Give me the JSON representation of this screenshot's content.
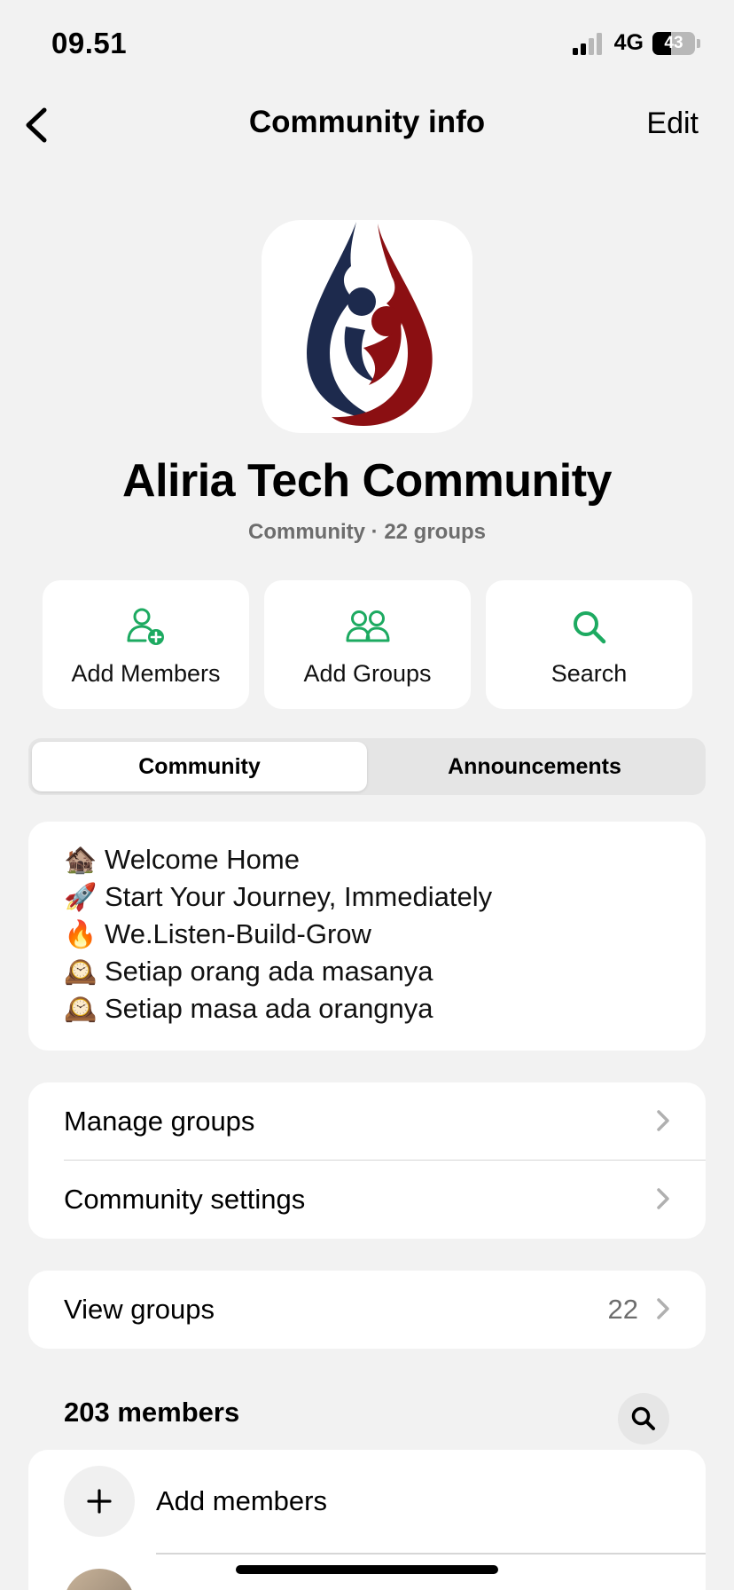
{
  "status_bar": {
    "time": "09.51",
    "network": "4G",
    "battery": "43",
    "battery_level": 0.43
  },
  "nav": {
    "title": "Community info",
    "edit_label": "Edit",
    "back_icon": "chevron-left-icon"
  },
  "community": {
    "name": "Aliria Tech Community",
    "subtitle": "Community · 22 groups"
  },
  "actions": [
    {
      "label": "Add Members",
      "icon": "add-person-icon"
    },
    {
      "label": "Add Groups",
      "icon": "group-icon"
    },
    {
      "label": "Search",
      "icon": "search-icon"
    }
  ],
  "tabs": [
    {
      "label": "Community",
      "active": true
    },
    {
      "label": "Announcements",
      "active": false
    }
  ],
  "description": [
    {
      "emoji": "🏚️",
      "text": "Welcome Home"
    },
    {
      "emoji": "🚀",
      "text": "Start Your Journey, Immediately"
    },
    {
      "emoji": "🔥",
      "text": "We.Listen-Build-Grow"
    },
    {
      "emoji": "🕰️",
      "text": "Setiap orang ada masanya"
    },
    {
      "emoji": "🕰️",
      "text": "Setiap masa ada orangnya"
    }
  ],
  "settings_list": [
    {
      "label": "Manage groups"
    },
    {
      "label": "Community settings"
    }
  ],
  "view_groups": {
    "label": "View groups",
    "count": "22"
  },
  "members": {
    "header": "203 members",
    "add_label": "Add members"
  },
  "colors": {
    "accent_green": "#1daa61",
    "logo_navy": "#1d2a4d",
    "logo_red": "#8b0f12",
    "background": "#f2f2f2"
  }
}
